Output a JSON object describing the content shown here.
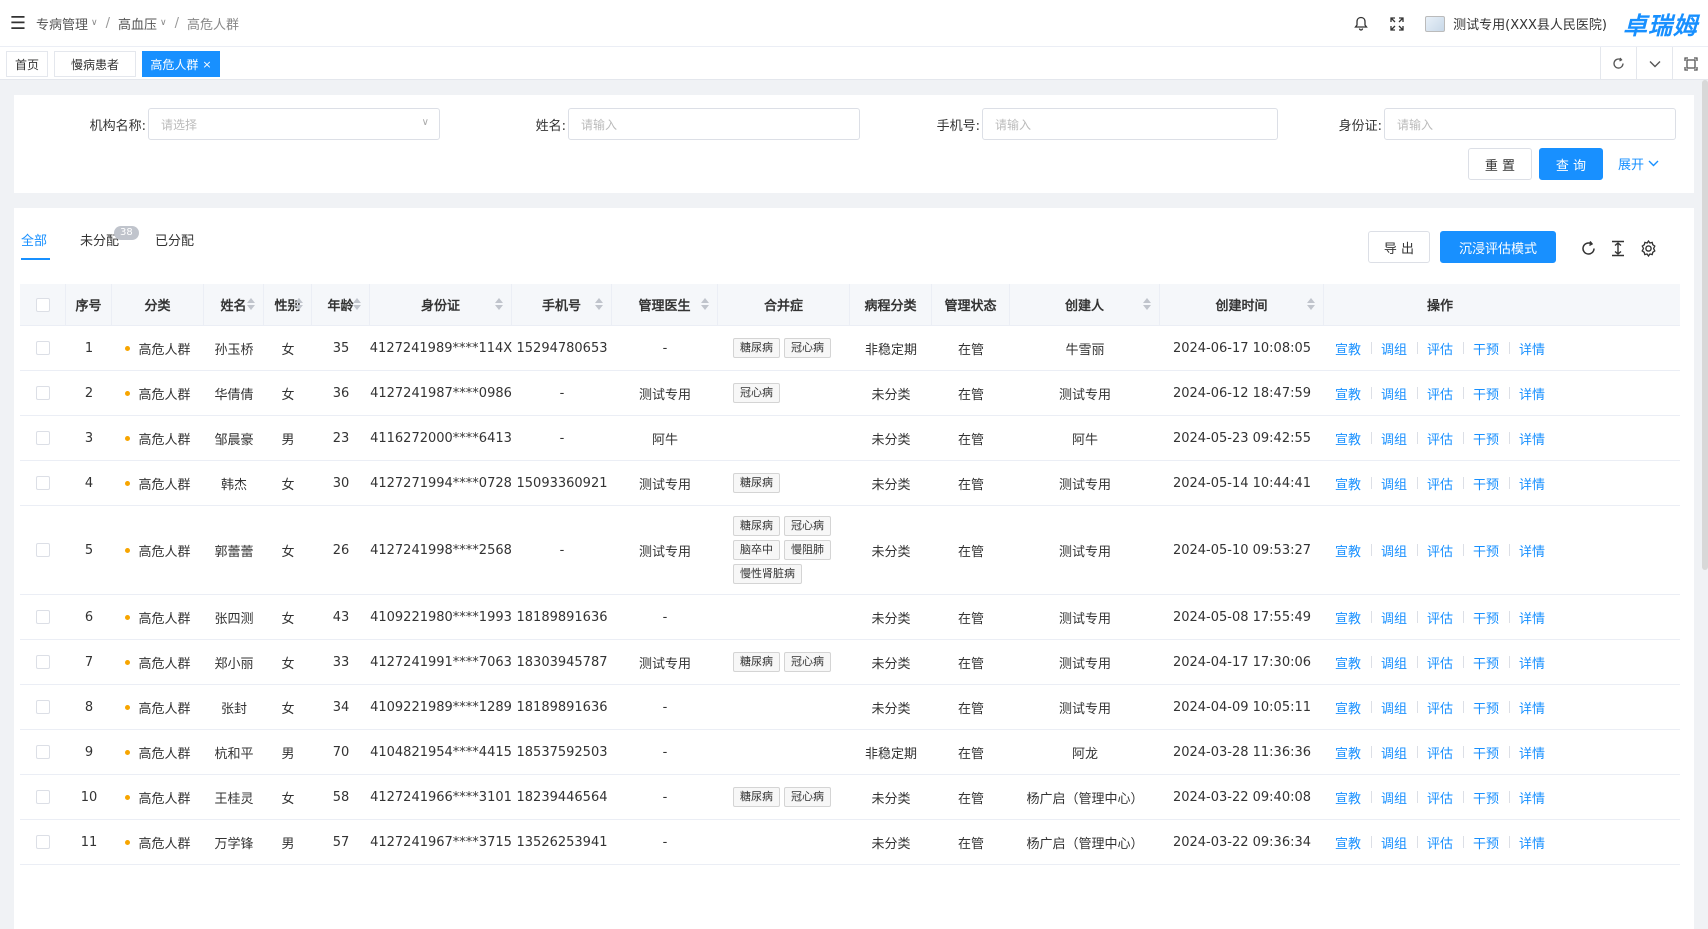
{
  "header": {
    "breadcrumb": [
      "专病管理",
      "高血压",
      "高危人群"
    ],
    "hospital": "测试专用(XXX县人民医院)",
    "brand": "卓瑞姆"
  },
  "tabs": [
    {
      "label": "首页",
      "active": false
    },
    {
      "label": "慢病患者",
      "active": false
    },
    {
      "label": "高危人群",
      "active": true
    }
  ],
  "tab_close": "×",
  "search": {
    "org_label": "机构名称:",
    "org_placeholder": "请选择",
    "name_label": "姓名:",
    "name_placeholder": "请输入",
    "phone_label": "手机号:",
    "phone_placeholder": "请输入",
    "id_label": "身份证:",
    "id_placeholder": "请输入",
    "reset": "重 置",
    "query": "查 询",
    "expand": "展开"
  },
  "subtabs": {
    "all": "全部",
    "unassigned": "未分配",
    "unassigned_count": "38",
    "assigned": "已分配"
  },
  "toolbar": {
    "export": "导 出",
    "immersive": "沉浸评估模式"
  },
  "columns": [
    "序号",
    "分类",
    "姓名",
    "性别",
    "年龄",
    "身份证",
    "手机号",
    "管理医生",
    "合并症",
    "病程分类",
    "管理状态",
    "创建人",
    "创建时间",
    "操作"
  ],
  "actions": [
    "宣教",
    "调组",
    "评估",
    "干预",
    "详情"
  ],
  "rows": [
    {
      "no": "1",
      "cat": "高危人群",
      "name": "孙玉桥",
      "sex": "女",
      "age": "35",
      "id": "4127241989****114X",
      "phone": "15294780653",
      "doctor": "-",
      "tags": [
        "糖尿病",
        "冠心病"
      ],
      "course": "非稳定期",
      "status": "在管",
      "creator": "牛雪丽",
      "time": "2024-06-17 10:08:05"
    },
    {
      "no": "2",
      "cat": "高危人群",
      "name": "华倩倩",
      "sex": "女",
      "age": "36",
      "id": "4127241987****0986",
      "phone": "-",
      "doctor": "测试专用",
      "tags": [
        "冠心病"
      ],
      "course": "未分类",
      "status": "在管",
      "creator": "测试专用",
      "time": "2024-06-12 18:47:59"
    },
    {
      "no": "3",
      "cat": "高危人群",
      "name": "邹晨豪",
      "sex": "男",
      "age": "23",
      "id": "4116272000****6413",
      "phone": "-",
      "doctor": "阿牛",
      "tags": [],
      "course": "未分类",
      "status": "在管",
      "creator": "阿牛",
      "time": "2024-05-23 09:42:55"
    },
    {
      "no": "4",
      "cat": "高危人群",
      "name": "韩杰",
      "sex": "女",
      "age": "30",
      "id": "4127271994****0728",
      "phone": "15093360921",
      "doctor": "测试专用",
      "tags": [
        "糖尿病"
      ],
      "course": "未分类",
      "status": "在管",
      "creator": "测试专用",
      "time": "2024-05-14 10:44:41"
    },
    {
      "no": "5",
      "cat": "高危人群",
      "name": "郭蕾蕾",
      "sex": "女",
      "age": "26",
      "id": "4127241998****2568",
      "phone": "-",
      "doctor": "测试专用",
      "tags": [
        "糖尿病",
        "冠心病",
        "脑卒中",
        "慢阻肺",
        "慢性肾脏病"
      ],
      "course": "未分类",
      "status": "在管",
      "creator": "测试专用",
      "time": "2024-05-10 09:53:27"
    },
    {
      "no": "6",
      "cat": "高危人群",
      "name": "张四测",
      "sex": "女",
      "age": "43",
      "id": "4109221980****1993",
      "phone": "18189891636",
      "doctor": "-",
      "tags": [],
      "course": "未分类",
      "status": "在管",
      "creator": "测试专用",
      "time": "2024-05-08 17:55:49"
    },
    {
      "no": "7",
      "cat": "高危人群",
      "name": "郑小丽",
      "sex": "女",
      "age": "33",
      "id": "4127241991****7063",
      "phone": "18303945787",
      "doctor": "测试专用",
      "tags": [
        "糖尿病",
        "冠心病"
      ],
      "course": "未分类",
      "status": "在管",
      "creator": "测试专用",
      "time": "2024-04-17 17:30:06"
    },
    {
      "no": "8",
      "cat": "高危人群",
      "name": "张封",
      "sex": "女",
      "age": "34",
      "id": "4109221989****1289",
      "phone": "18189891636",
      "doctor": "-",
      "tags": [],
      "course": "未分类",
      "status": "在管",
      "creator": "测试专用",
      "time": "2024-04-09 10:05:11"
    },
    {
      "no": "9",
      "cat": "高危人群",
      "name": "杭和平",
      "sex": "男",
      "age": "70",
      "id": "4104821954****4415",
      "phone": "18537592503",
      "doctor": "-",
      "tags": [],
      "course": "非稳定期",
      "status": "在管",
      "creator": "阿龙",
      "time": "2024-03-28 11:36:36"
    },
    {
      "no": "10",
      "cat": "高危人群",
      "name": "王桂灵",
      "sex": "女",
      "age": "58",
      "id": "4127241966****3101",
      "phone": "18239446564",
      "doctor": "-",
      "tags": [
        "糖尿病",
        "冠心病"
      ],
      "course": "未分类",
      "status": "在管",
      "creator": "杨广启（管理中心）",
      "time": "2024-03-22 09:40:08"
    },
    {
      "no": "11",
      "cat": "高危人群",
      "name": "万学锋",
      "sex": "男",
      "age": "57",
      "id": "4127241967****3715",
      "phone": "13526253941",
      "doctor": "-",
      "tags": [],
      "course": "未分类",
      "status": "在管",
      "creator": "杨广启（管理中心）",
      "time": "2024-03-22 09:36:34"
    }
  ]
}
